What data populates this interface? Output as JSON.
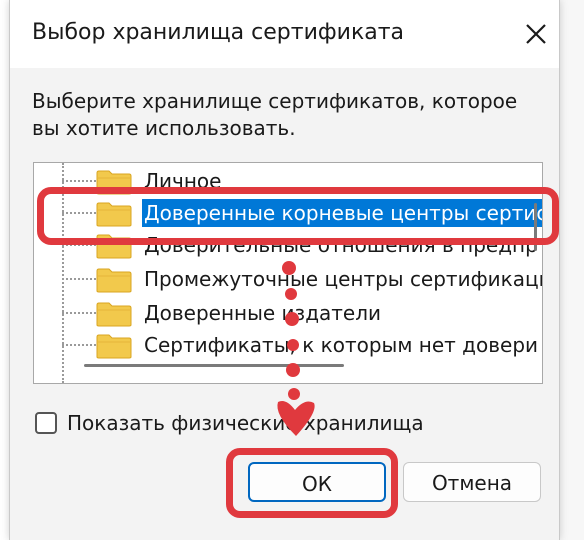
{
  "dialog": {
    "title": "Выбор хранилища сертификата",
    "prompt": "Выберите хранилище сертификатов, которое вы хотите использовать.",
    "close_icon": "close-icon"
  },
  "tree": {
    "items": [
      {
        "label": "Личное",
        "selected": false
      },
      {
        "label": "Доверенные корневые центры сертис",
        "selected": true
      },
      {
        "label": "Доверительные отношения в предпр",
        "selected": false
      },
      {
        "label": "Промежуточные центры сертификаци",
        "selected": false
      },
      {
        "label": "Доверенные издатели",
        "selected": false
      },
      {
        "label": "Сертификаты, к которым нет довери",
        "selected": false
      }
    ],
    "folder_icon": "folder-icon"
  },
  "checkbox": {
    "label": "Показать физические хранилища",
    "checked": false
  },
  "buttons": {
    "ok": "ОК",
    "cancel": "Отмена"
  },
  "colors": {
    "accent": "#0078d7",
    "annotation": "#e0393e",
    "folder": "#f2c94c"
  }
}
